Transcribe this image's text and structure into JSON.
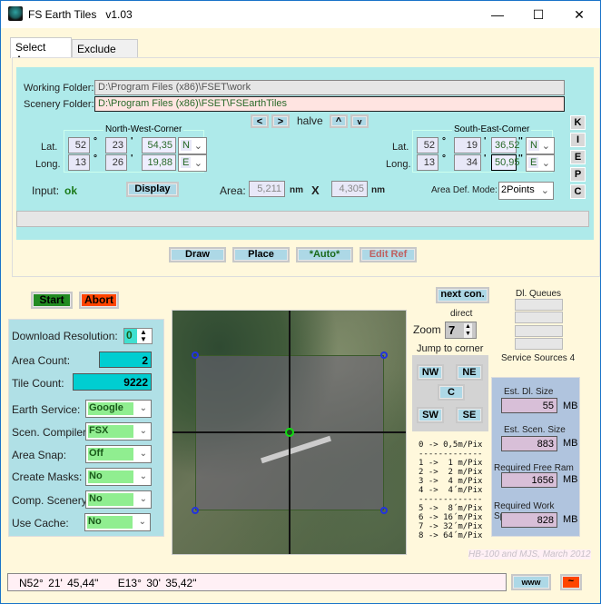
{
  "window": {
    "title": "FS Earth Tiles   v1.03",
    "minimize": "—",
    "maximize": "☐",
    "close": "✕"
  },
  "tabs": [
    {
      "label": "Select Area",
      "active": true
    },
    {
      "label": "Exclude Area",
      "active": false
    }
  ],
  "folders": {
    "working_label": "Working Folder:",
    "working_value": "D:\\Program Files (x86)\\FSET\\work",
    "scenery_label": "Scenery Folder:",
    "scenery_value": "D:\\Program Files (x86)\\FSET\\FSEarthTiles"
  },
  "nav": {
    "left": "<",
    "right": ">",
    "halve": "halve",
    "up": "^",
    "down": "v"
  },
  "nw": {
    "title": "North-West-Corner",
    "lat_label": "Lat.",
    "long_label": "Long.",
    "lat": [
      "52",
      "23",
      "54,35"
    ],
    "lat_dir": "N",
    "long": [
      "13",
      "26",
      "19,88"
    ],
    "long_dir": "E"
  },
  "se": {
    "title": "South-East-Corner",
    "lat_label": "Lat.",
    "long_label": "Long.",
    "lat": [
      "52",
      "19",
      "36,52"
    ],
    "lat_dir": "N",
    "long": [
      "13",
      "34",
      "50,95"
    ],
    "long_dir": "E"
  },
  "symbols": {
    "deg": "°",
    "min": "'",
    "sec": "''"
  },
  "side_buttons": [
    "K",
    "I",
    "E",
    "P",
    "C"
  ],
  "input": {
    "label": "Input:",
    "status": "ok",
    "display": "Display",
    "area_label": "Area:",
    "area_w": "5,211",
    "unit": "nm",
    "x": "X",
    "area_h": "4,305",
    "mode_label": "Area Def. Mode:",
    "mode": "2Points"
  },
  "actions": {
    "draw": "Draw",
    "place": "Place",
    "auto": "*Auto*",
    "edit_ref": "Edit Ref"
  },
  "run": {
    "start": "Start",
    "abort": "Abort"
  },
  "settings": {
    "download_resolution_label": "Download Resolution:",
    "download_resolution": "0",
    "area_count_label": "Area Count:",
    "area_count": "2",
    "tile_count_label": "Tile Count:",
    "tile_count": "9222",
    "rows": [
      {
        "label": "Earth Service:",
        "value": "Google"
      },
      {
        "label": "Scen. Compiler:",
        "value": "FSX"
      },
      {
        "label": "Area Snap:",
        "value": "Off"
      },
      {
        "label": "Create Masks:",
        "value": "No"
      },
      {
        "label": "Comp. Scenery:",
        "value": "No"
      },
      {
        "label": "Use Cache:",
        "value": "No"
      }
    ]
  },
  "map_controls": {
    "next_con": "next con.",
    "direct": "direct",
    "zoom_label": "Zoom",
    "zoom": "7",
    "jump_label": "Jump to corner",
    "nw": "NW",
    "ne": "NE",
    "c": "C",
    "sw": "SW",
    "se": "SE"
  },
  "resolution_legend": "0 -> 0,5m/Pix\n-------------\n1 ->  1 m/Pix\n2 ->  2 m/Pix\n3 ->  4 m/Pix\n4 ->  4´m/Pix\n-------------\n5 ->  8´m/Pix\n6 -> 16´m/Pix\n7 -> 32´m/Pix\n8 -> 64´m/Pix",
  "queues": {
    "title": "Dl. Queues",
    "service_sources": "Service Sources 4"
  },
  "estimates": {
    "dl_label": "Est. Dl. Size",
    "dl": "55",
    "scen_label": "Est. Scen. Size",
    "scen": "883",
    "ram_label": "Required Free Ram",
    "ram": "1656",
    "work_label": "Required Work Space",
    "work": "828",
    "unit": "MB"
  },
  "credit": "HB-100 and MJS, March 2012",
  "status": {
    "coords": "N52° 21' 45,44\"    E13° 30' 35,42\"",
    "www": "www",
    "tilde": "~"
  }
}
